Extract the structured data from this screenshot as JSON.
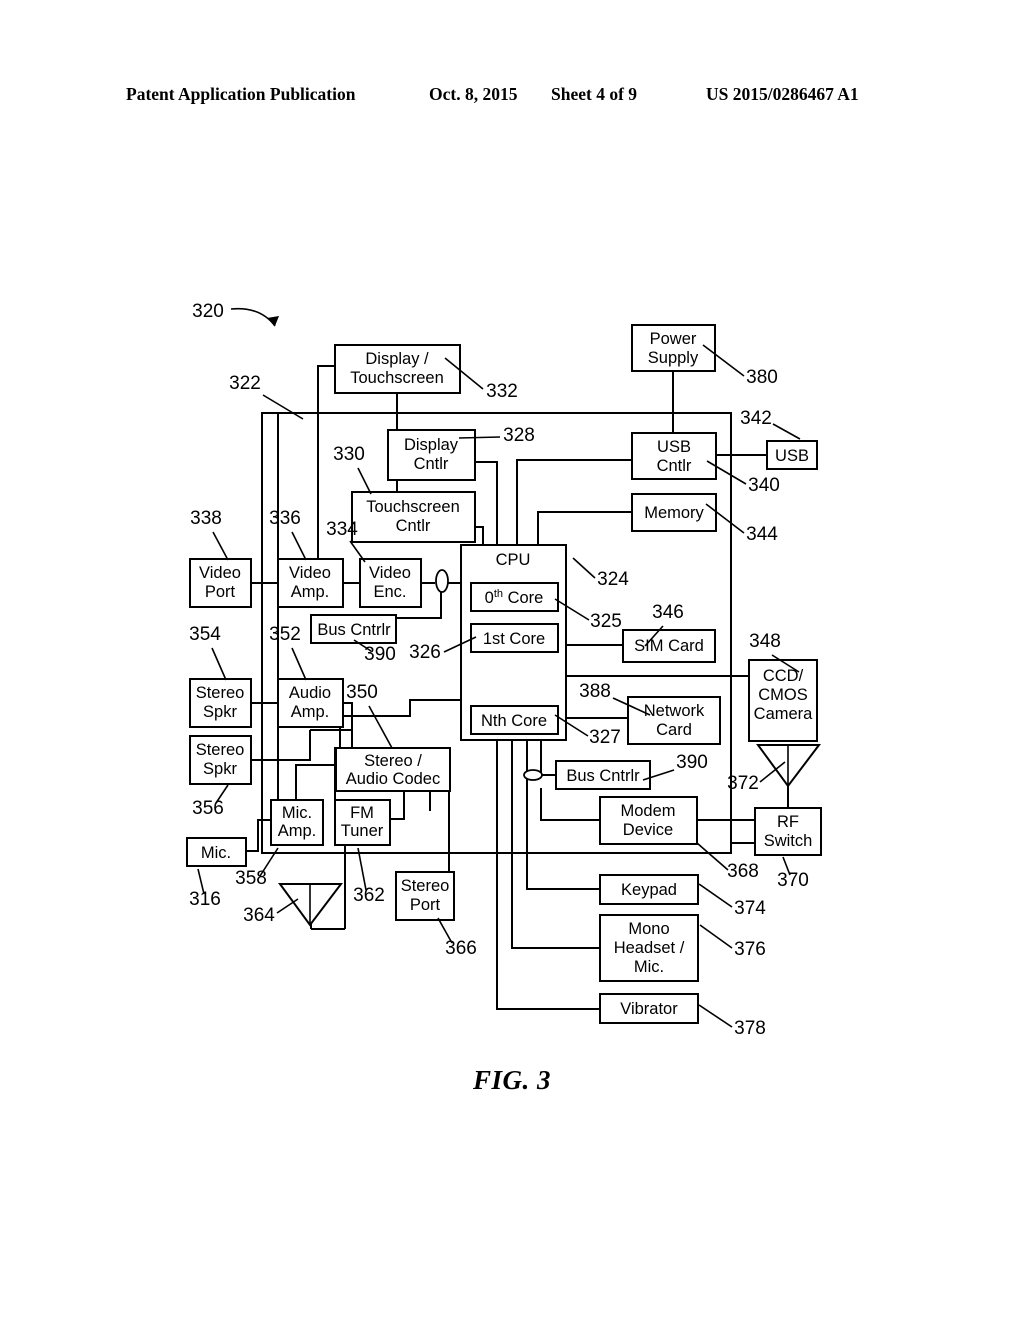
{
  "header": {
    "publication": "Patent Application Publication",
    "date": "Oct. 8, 2015",
    "sheet": "Sheet 4 of 9",
    "number": "US 2015/0286467 A1"
  },
  "figure": {
    "label": "FIG. 3",
    "system_ref": "320",
    "enclosure_ref": "322"
  },
  "blocks": {
    "display_touchscreen": {
      "label_line1": "Display /",
      "label_line2": "Touchscreen",
      "ref": "332"
    },
    "display_cntlr": {
      "label_line1": "Display",
      "label_line2": "Cntlr",
      "ref": "328"
    },
    "touchscreen_cntlr": {
      "label_line1": "Touchscreen",
      "label_line2": "Cntlr",
      "ref": "330"
    },
    "power_supply": {
      "label_line1": "Power",
      "label_line2": "Supply",
      "ref": "380"
    },
    "usb_cntlr": {
      "label_line1": "USB",
      "label_line2": "Cntlr",
      "ref": "340"
    },
    "usb": {
      "label_line1": "USB",
      "ref": "342"
    },
    "memory": {
      "label_line1": "Memory",
      "ref": "344"
    },
    "cpu": {
      "label_line1": "CPU",
      "ref": "324"
    },
    "core_0": {
      "label_pre": "0",
      "label_sup": "th",
      "label_post": " Core",
      "ref": "325"
    },
    "core_1": {
      "label_line1": "1st Core",
      "ref": "326"
    },
    "core_n": {
      "label_line1": "Nth Core",
      "ref": "327"
    },
    "sim_card": {
      "label_line1": "SIM Card",
      "ref": "346"
    },
    "network_card": {
      "label_line1": "Network",
      "label_line2": "Card",
      "ref": "388"
    },
    "ccd_cmos_camera": {
      "label_line1": "CCD/",
      "label_line2": "CMOS",
      "label_line3": "Camera",
      "ref": "348"
    },
    "bus_cntlr_video": {
      "label_line1": "Bus Cntrlr",
      "ref": "390"
    },
    "bus_cntlr_modem": {
      "label_line1": "Bus Cntrlr",
      "ref": "390"
    },
    "video_port": {
      "label_line1": "Video",
      "label_line2": "Port",
      "ref": "338"
    },
    "video_amp": {
      "label_line1": "Video",
      "label_line2": "Amp.",
      "ref": "336"
    },
    "video_enc": {
      "label_line1": "Video",
      "label_line2": "Enc.",
      "ref": "334"
    },
    "stereo_spkr_1": {
      "label_line1": "Stereo",
      "label_line2": "Spkr",
      "ref": "354"
    },
    "stereo_spkr_2": {
      "label_line1": "Stereo",
      "label_line2": "Spkr",
      "ref": "356"
    },
    "audio_amp": {
      "label_line1": "Audio",
      "label_line2": "Amp.",
      "ref": "352"
    },
    "stereo_audio_codec": {
      "label_line1": "Stereo /",
      "label_line2": "Audio Codec",
      "ref": "350"
    },
    "mic_amp": {
      "label_line1": "Mic.",
      "label_line2": "Amp.",
      "ref": "358"
    },
    "mic": {
      "label_line1": "Mic.",
      "ref": "316"
    },
    "fm_tuner": {
      "label_line1": "FM",
      "label_line2": "Tuner",
      "ref": "362"
    },
    "stereo_port": {
      "label_line1": "Stereo",
      "label_line2": "Port",
      "ref": "366"
    },
    "modem_device": {
      "label_line1": "Modem",
      "label_line2": "Device",
      "ref": "368"
    },
    "rf_switch": {
      "label_line1": "RF",
      "label_line2": "Switch",
      "ref": "370"
    },
    "keypad": {
      "label_line1": "Keypad",
      "ref": "374"
    },
    "mono_headset": {
      "label_line1": "Mono",
      "label_line2": "Headset /",
      "label_line3": "Mic.",
      "ref": "376"
    },
    "vibrator": {
      "label_line1": "Vibrator",
      "ref": "378"
    }
  },
  "antennas": {
    "fm_antenna": {
      "ref": "364"
    },
    "rf_antenna": {
      "ref": "372"
    }
  }
}
